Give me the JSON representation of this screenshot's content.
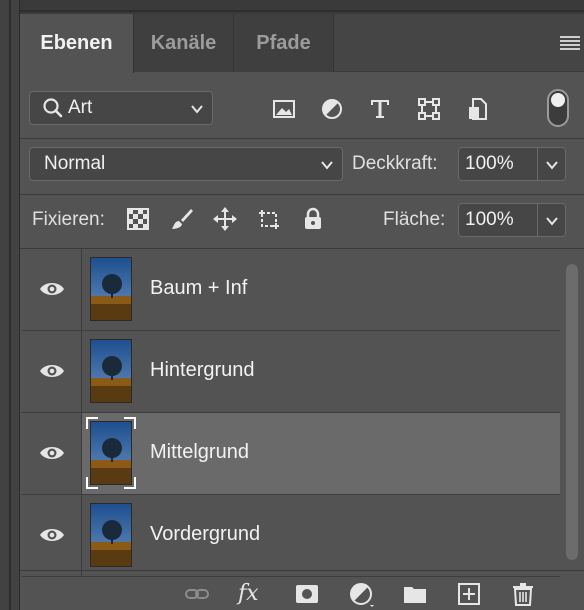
{
  "tabs": [
    {
      "label": "Ebenen",
      "active": true
    },
    {
      "label": "Kanäle",
      "active": false
    },
    {
      "label": "Pfade",
      "active": false
    }
  ],
  "filter": {
    "kind_label": "Art",
    "icons": [
      "image-filter-icon",
      "adjustment-filter-icon",
      "type-filter-icon",
      "shape-filter-icon",
      "smart-object-filter-icon"
    ],
    "toggle_on": true
  },
  "blend": {
    "mode": "Normal",
    "opacity_label": "Deckkraft:",
    "opacity_value": "100%"
  },
  "lock": {
    "label": "Fixieren:",
    "icons": [
      "lock-transparent-pixels-icon",
      "lock-image-pixels-icon",
      "lock-position-icon",
      "lock-artboard-icon",
      "lock-all-icon"
    ],
    "fill_label": "Fläche:",
    "fill_value": "100%"
  },
  "layers": [
    {
      "name": "Baum + Inf",
      "visible": true,
      "selected": false
    },
    {
      "name": "Hintergrund",
      "visible": true,
      "selected": false
    },
    {
      "name": "Mittelgrund",
      "visible": true,
      "selected": true
    },
    {
      "name": "Vordergrund",
      "visible": true,
      "selected": false
    }
  ],
  "footer": {
    "icons": [
      "link-layers-icon",
      "fx-icon",
      "add-mask-icon",
      "new-adjustment-layer-icon",
      "new-group-icon",
      "new-layer-icon",
      "delete-layer-icon"
    ],
    "fx_text": "fx"
  },
  "colors": {
    "panel": "#535353",
    "selected_row": "#6a6a6a",
    "text": "#f2f2f2"
  }
}
